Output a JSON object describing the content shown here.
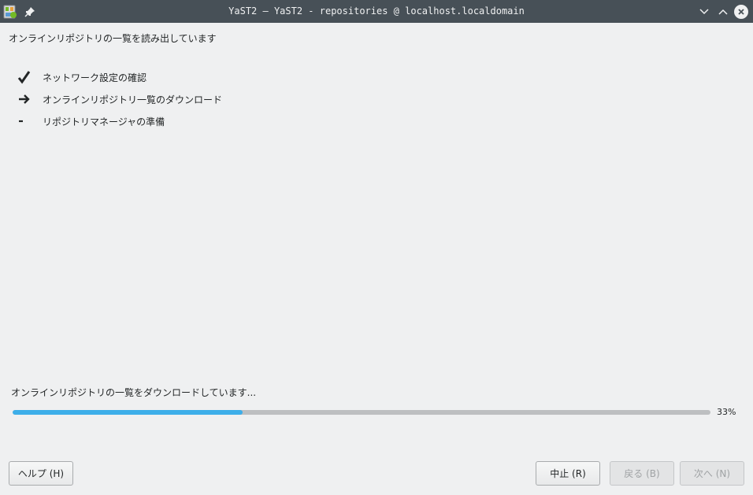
{
  "window": {
    "title": "YaST2 — YaST2 - repositories @ localhost.localdomain"
  },
  "heading": "オンラインリポジトリの一覧を読み出しています",
  "steps": [
    {
      "status": "done",
      "icon": "checkmark-icon",
      "label": "ネットワーク設定の確認"
    },
    {
      "status": "current",
      "icon": "arrow-right-icon",
      "label": "オンラインリポジトリ一覧のダウンロード"
    },
    {
      "status": "pending",
      "icon": "dash-icon",
      "label": "リポジトリマネージャの準備"
    }
  ],
  "progress": {
    "label": "オンラインリポジトリの一覧をダウンロードしています...",
    "value": 0.33,
    "percent_text": "33%",
    "color": "#3daee9"
  },
  "buttons": {
    "help": "ヘルプ (H)",
    "abort": "中止 (R)",
    "back": "戻る (B)",
    "next": "次へ (N)"
  }
}
